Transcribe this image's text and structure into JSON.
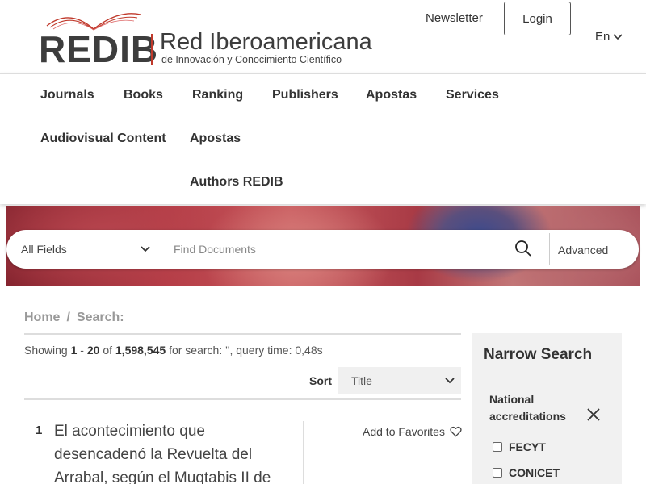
{
  "header": {
    "logo_text": "REDIB",
    "logo_name": "Red Iberoamericana",
    "logo_subtitle": "de Innovación y Conocimiento Científico",
    "newsletter": "Newsletter",
    "login": "Login",
    "language": "En"
  },
  "nav": {
    "items": [
      "Journals",
      "Books",
      "Ranking",
      "Publishers",
      "Apostas",
      "Services",
      "Audiovisual Content",
      "Apostas",
      "Authors REDIB"
    ]
  },
  "search": {
    "field": "All Fields",
    "placeholder": "Find Documents",
    "advanced": "Advanced"
  },
  "breadcrumb": {
    "home": "Home",
    "sep": "/",
    "current": "Search:"
  },
  "results": {
    "showing_label": "Showing",
    "range_start": "1",
    "range_dash": "-",
    "range_end": "20",
    "of_label": "of",
    "total": "1,598,545",
    "suffix": "for search: '', query time: 0,48s",
    "sort_label": "Sort",
    "sort_value": "Title",
    "items": [
      {
        "number": "1",
        "title": "El acontecimiento que desencadenó la Revuelta del Arrabal, según el Muqtabis II de",
        "favorites": "Add to Favorites"
      }
    ]
  },
  "sidebar": {
    "title": "Narrow Search",
    "facet_title": "National accreditations",
    "facet_items": [
      "FECYT",
      "CONICET"
    ]
  },
  "colors": {
    "logo_accent": "#c0392b",
    "text_dark": "#333333",
    "sidebar_bg": "#f1f1f1"
  }
}
